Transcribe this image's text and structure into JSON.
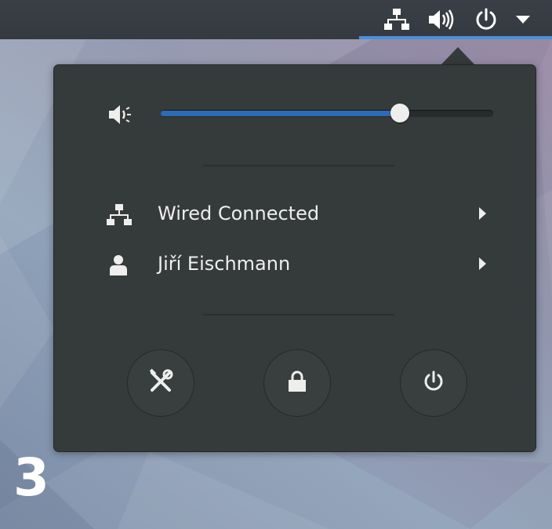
{
  "topbar": {
    "icons": [
      "network-wired-icon",
      "volume-high-icon",
      "power-icon",
      "dropdown-arrow-icon"
    ]
  },
  "volume": {
    "icon": "volume-low-icon",
    "level_fraction": 0.72
  },
  "menu_items": [
    {
      "icon": "network-wired-icon",
      "label": "Wired Connected"
    },
    {
      "icon": "user-icon",
      "label": "Jiří Eischmann"
    }
  ],
  "actions": [
    {
      "icon": "settings-tools-icon"
    },
    {
      "icon": "lock-icon"
    },
    {
      "icon": "power-icon"
    }
  ],
  "colors": {
    "accent": "#4a90d9",
    "slider_fill": "#2c6cb7",
    "menu_bg": "#353a3b",
    "topbar_bg": "#3a3f47",
    "text": "#eeeeec"
  },
  "step_badge": "3"
}
